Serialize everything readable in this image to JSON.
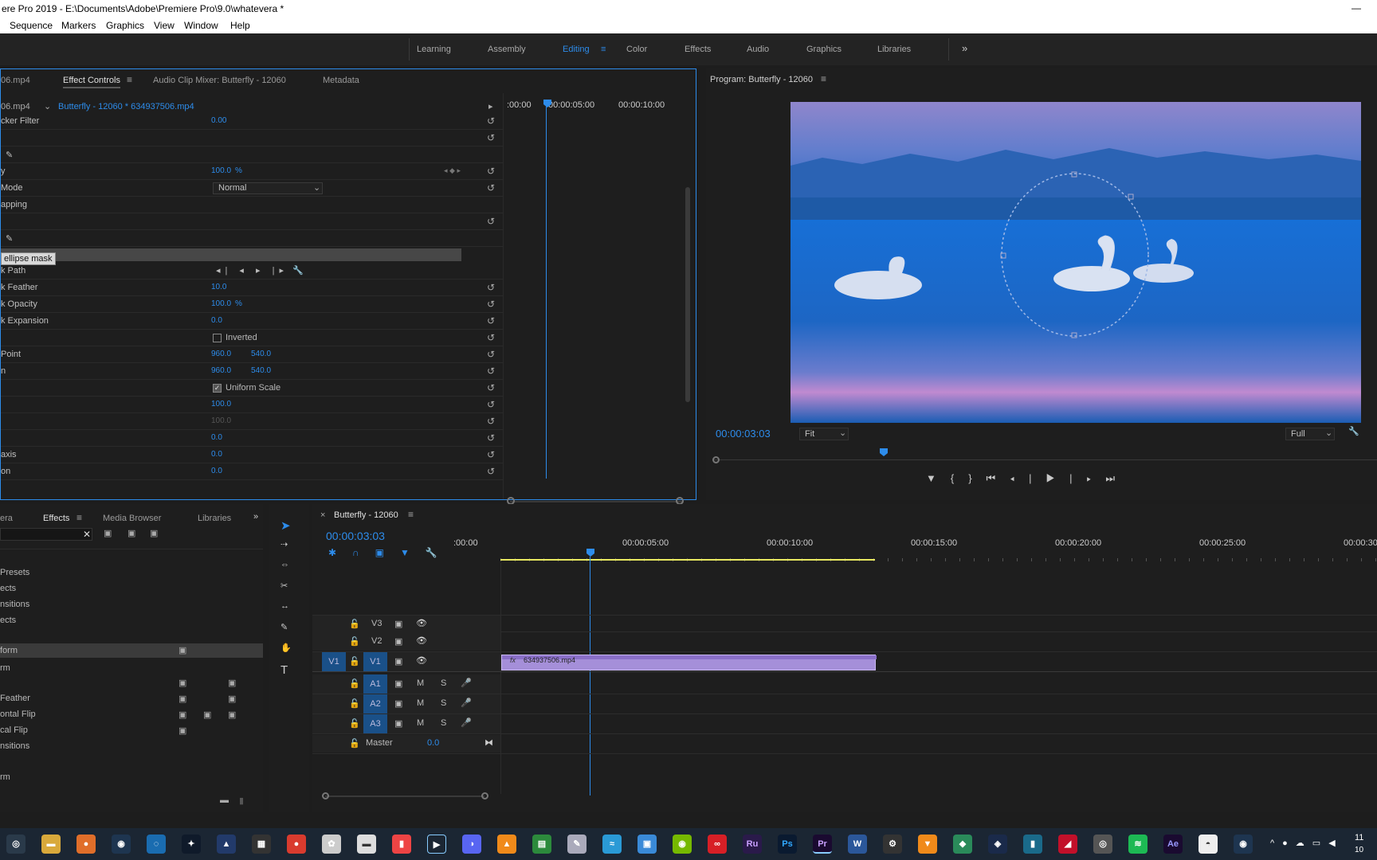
{
  "window": {
    "title": "ere Pro 2019 - E:\\Documents\\Adobe\\Premiere Pro\\9.0\\whatevera *",
    "minimize": "—"
  },
  "menu": [
    "Sequence",
    "Markers",
    "Graphics",
    "View",
    "Window",
    "Help"
  ],
  "workspaces": {
    "items": [
      "Learning",
      "Assembly",
      "Editing",
      "Color",
      "Effects",
      "Audio",
      "Graphics",
      "Libraries"
    ],
    "active": "Editing",
    "more": "»"
  },
  "effect_controls": {
    "tabs": [
      "06.mp4",
      "Effect Controls",
      "Audio Clip Mixer: Butterfly - 12060",
      "Metadata"
    ],
    "source": "06.mp4",
    "clip": "Butterfly - 12060 * 634937506.mp4",
    "timecodes": [
      ":00:00",
      "00:00:05:00",
      "00:00:10:00"
    ],
    "rows": [
      {
        "label": "cker Filter",
        "v1": "0.00"
      },
      {
        "label": "",
        "v1": ""
      },
      {
        "label": "",
        "v1": ""
      },
      {
        "label": "y",
        "v1": "100.0",
        "unit": "%"
      },
      {
        "label": "Mode",
        "select": "Normal"
      },
      {
        "label": "apping",
        "v1": ""
      },
      {
        "label": "",
        "v1": ""
      },
      {
        "label": "",
        "v1": ""
      },
      {
        "label": "ellipse mask",
        "v1": ""
      },
      {
        "label": "k Path",
        "v1": ""
      },
      {
        "label": "k Feather",
        "v1": "10.0"
      },
      {
        "label": "k Opacity",
        "v1": "100.0",
        "unit": "%"
      },
      {
        "label": "k Expansion",
        "v1": "0.0"
      },
      {
        "label": "",
        "checkbox": "Inverted"
      },
      {
        "label": "Point",
        "v1": "960.0",
        "v2": "540.0"
      },
      {
        "label": "n",
        "v1": "960.0",
        "v2": "540.0"
      },
      {
        "label": "",
        "checkbox": "Uniform Scale"
      },
      {
        "label": "",
        "v1": "100.0"
      },
      {
        "label": "",
        "v1": "100.0"
      },
      {
        "label": "",
        "v1": "0.0"
      },
      {
        "label": "axis",
        "v1": "0.0"
      },
      {
        "label": "on",
        "v1": "0.0"
      }
    ]
  },
  "program": {
    "title": "Program: Butterfly - 12060",
    "timecode": "00:00:03:03",
    "fit": "Fit",
    "quality": "Full",
    "playhead_fraction": 0.25
  },
  "effects_panel": {
    "tabs": [
      "era",
      "Effects",
      "Media Browser",
      "Libraries"
    ],
    "items": [
      "Presets",
      "ects",
      "nsitions",
      "ects",
      "",
      "form",
      "rm",
      "",
      "Feather",
      "ontal Flip",
      "cal Flip",
      "nsitions",
      "",
      "rm"
    ]
  },
  "timeline": {
    "sequence": "Butterfly - 12060",
    "timecode": "00:00:03:03",
    "ruler": [
      ":00:00",
      "00:00:05:00",
      "00:00:10:00",
      "00:00:15:00",
      "00:00:20:00",
      "00:00:25:00",
      "00:00:30"
    ],
    "video_tracks": [
      "V3",
      "V2",
      "V1"
    ],
    "audio_tracks": [
      "A1",
      "A2",
      "A3"
    ],
    "master": {
      "label": "Master",
      "value": "0.0"
    },
    "clip": "634937506.mp4",
    "source_patch": "V1",
    "mute": "M",
    "solo": "S"
  },
  "taskbar": {
    "apps": [
      "Chrome",
      "Ru",
      "Ps",
      "Pr",
      "W",
      "Ae"
    ],
    "clock": "11",
    "date": "10"
  }
}
